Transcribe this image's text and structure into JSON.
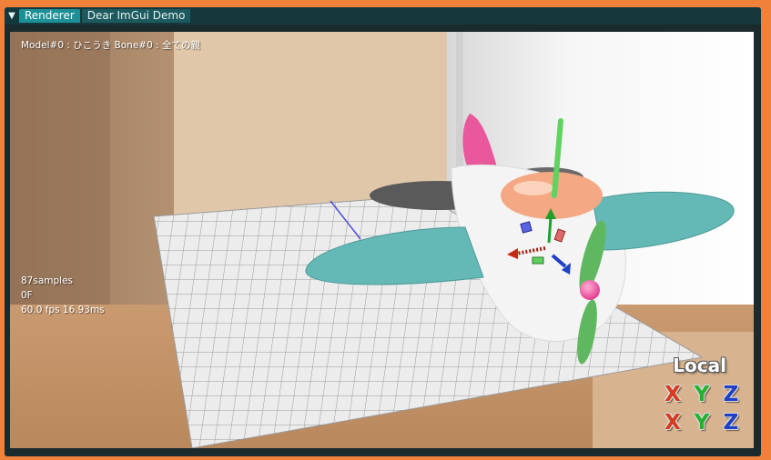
{
  "tabs": [
    {
      "label": "Renderer",
      "active": true
    },
    {
      "label": "Dear ImGui Demo",
      "active": false
    }
  ],
  "menu_icon": "triangle-down-icon",
  "viewport": {
    "model_info": "Model#0 : ひこうき Bone#0 : 全ての親",
    "samples": "87samples",
    "frame": "0F",
    "fps": "60.0 fps 16.93ms"
  },
  "gizmo": {
    "mode_label": "Local",
    "row1": [
      "X",
      "Y",
      "Z"
    ],
    "row2": [
      "X",
      "Y",
      "Z"
    ]
  },
  "colors": {
    "accent": "#1d8f96",
    "frame_border": "#f0813a",
    "axis_x": "#d83a1e",
    "axis_y": "#25b030",
    "axis_z": "#1f3fc4",
    "wing": "#64b8b6",
    "propeller": "#5fb85f",
    "tail_fin": "#e9589c",
    "canopy": "#f4a883"
  }
}
